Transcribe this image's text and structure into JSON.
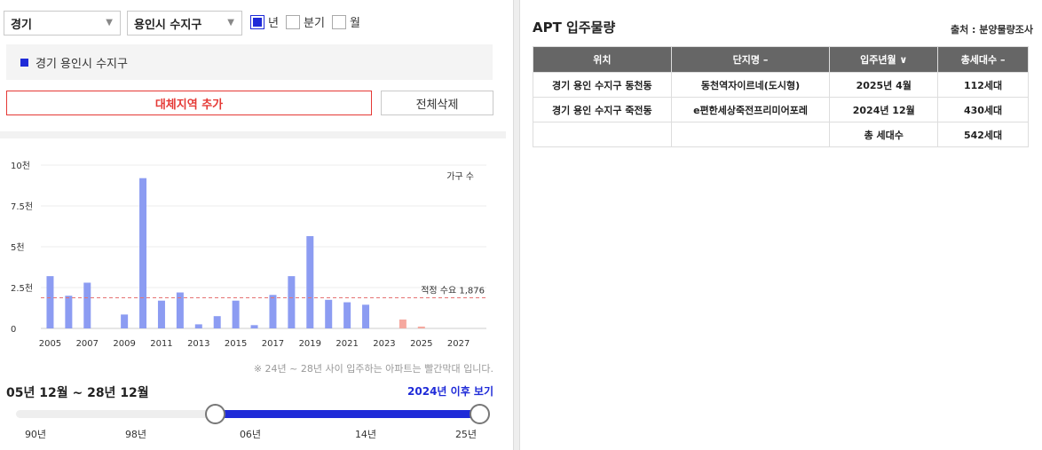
{
  "filters": {
    "province": "경기",
    "city": "용인시 수지구",
    "period_options": [
      {
        "label": "년",
        "checked": true
      },
      {
        "label": "분기",
        "checked": false
      },
      {
        "label": "월",
        "checked": false
      }
    ]
  },
  "region": {
    "label": "경기 용인시 수지구"
  },
  "buttons": {
    "add_region": "대체지역 추가",
    "delete_all": "전체삭제"
  },
  "chart_data": {
    "type": "bar",
    "categories": [
      "2005",
      "2006",
      "2007",
      "2008",
      "2009",
      "2010",
      "2011",
      "2012",
      "2013",
      "2014",
      "2015",
      "2016",
      "2017",
      "2018",
      "2019",
      "2020",
      "2021",
      "2022",
      "2023",
      "2024",
      "2025",
      "2026",
      "2027",
      "2028"
    ],
    "values": [
      3200,
      2000,
      2800,
      0,
      850,
      9200,
      1700,
      2200,
      250,
      750,
      1700,
      200,
      2050,
      3200,
      5650,
      1750,
      1600,
      1450,
      0,
      542,
      112,
      0,
      0,
      0
    ],
    "forecast_from": "2024",
    "series_color": "#8c9cf2",
    "forecast_color": "#f5a89f",
    "ylim": [
      0,
      10000
    ],
    "y_ticks": [
      {
        "value": 0,
        "label": "0"
      },
      {
        "value": 2500,
        "label": "2.5천"
      },
      {
        "value": 5000,
        "label": "5천"
      },
      {
        "value": 7500,
        "label": "7.5천"
      },
      {
        "value": 10000,
        "label": "10천"
      }
    ],
    "x_tick_labels": [
      "2005",
      "2007",
      "2009",
      "2011",
      "2013",
      "2015",
      "2017",
      "2019",
      "2021",
      "2023",
      "2025",
      "2027"
    ],
    "legend": "가구 수",
    "reference_line": {
      "value": 1876,
      "label": "적정 수요 1,876",
      "color": "#e57373"
    },
    "grid": true
  },
  "chart_note": "※ 24년 ~ 28년 사이 입주하는 아파트는 빨간막대 입니다.",
  "range": {
    "label": "05년 12월 ~ 28년 12월",
    "after_link": "2024년 이후 보기"
  },
  "slider": {
    "ticks": [
      "90년",
      "98년",
      "06년",
      "14년",
      "25년"
    ],
    "start_fraction": 0.43,
    "end_fraction": 1.0
  },
  "apt_table": {
    "title": "APT 입주물량",
    "source": "출처 : 분양물량조사",
    "headers": [
      "위치",
      "단지명 –",
      "입주년월 ∨",
      "총세대수 –"
    ],
    "rows": [
      [
        "경기 용인 수지구 동천동",
        "동천역자이르네(도시형)",
        "2025년 4월",
        "112세대"
      ],
      [
        "경기 용인 수지구 죽전동",
        "e편한세상죽전프리미어포레",
        "2024년 12월",
        "430세대"
      ]
    ],
    "total_label": "총 세대수",
    "total_value": "542세대"
  },
  "colors": {
    "accent_blue": "#1f2bd8",
    "accent_red": "#e53935",
    "table_header": "#666666"
  }
}
